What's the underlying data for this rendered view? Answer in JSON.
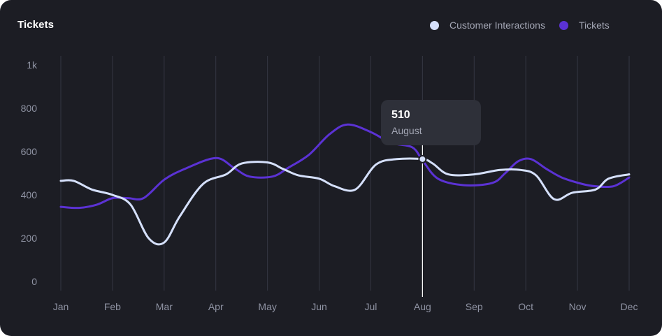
{
  "card": {
    "title": "Tickets"
  },
  "legend": {
    "items": [
      {
        "label": "Customer Interactions",
        "color": "#d5e0fb"
      },
      {
        "label": "Tickets",
        "color": "#5b32d4"
      }
    ]
  },
  "tooltip": {
    "value": "510",
    "label": "August"
  },
  "chart_data": {
    "type": "line",
    "title": "Tickets",
    "categories": [
      "Jan",
      "Feb",
      "Mar",
      "Apr",
      "May",
      "Jun",
      "Jul",
      "Aug",
      "Sep",
      "Oct",
      "Nov",
      "Dec"
    ],
    "yticks": [
      "0",
      "200",
      "400",
      "600",
      "800",
      "1k"
    ],
    "ylim": [
      0,
      1000
    ],
    "grid": "vertical",
    "legend_position": "top-right",
    "highlight": {
      "category": "Aug",
      "series": "Customer Interactions",
      "value": 510
    },
    "series": [
      {
        "name": "Customer Interactions",
        "color": "#d5e0fb",
        "points": [
          [
            0,
            465
          ],
          [
            0.25,
            465
          ],
          [
            0.6,
            425
          ],
          [
            1.0,
            400
          ],
          [
            1.35,
            355
          ],
          [
            1.7,
            200
          ],
          [
            2.0,
            180
          ],
          [
            2.3,
            300
          ],
          [
            2.75,
            450
          ],
          [
            3.2,
            495
          ],
          [
            3.5,
            545
          ],
          [
            4.0,
            550
          ],
          [
            4.3,
            520
          ],
          [
            4.6,
            490
          ],
          [
            5.0,
            475
          ],
          [
            5.3,
            440
          ],
          [
            5.7,
            425
          ],
          [
            6.1,
            540
          ],
          [
            6.5,
            565
          ],
          [
            7.0,
            565
          ],
          [
            7.2,
            545
          ],
          [
            7.5,
            495
          ],
          [
            8.0,
            495
          ],
          [
            8.5,
            515
          ],
          [
            8.9,
            515
          ],
          [
            9.2,
            490
          ],
          [
            9.55,
            380
          ],
          [
            9.9,
            410
          ],
          [
            10.35,
            425
          ],
          [
            10.6,
            475
          ],
          [
            11.0,
            495
          ]
        ]
      },
      {
        "name": "Tickets",
        "color": "#5b32d4",
        "points": [
          [
            0,
            345
          ],
          [
            0.35,
            340
          ],
          [
            0.7,
            355
          ],
          [
            1.0,
            385
          ],
          [
            1.3,
            385
          ],
          [
            1.6,
            385
          ],
          [
            2.0,
            470
          ],
          [
            2.4,
            520
          ],
          [
            3.0,
            570
          ],
          [
            3.35,
            525
          ],
          [
            3.65,
            485
          ],
          [
            4.1,
            485
          ],
          [
            4.4,
            525
          ],
          [
            4.8,
            585
          ],
          [
            5.2,
            680
          ],
          [
            5.55,
            725
          ],
          [
            6.0,
            690
          ],
          [
            6.4,
            640
          ],
          [
            6.8,
            620
          ],
          [
            7.0,
            560
          ],
          [
            7.3,
            475
          ],
          [
            7.8,
            445
          ],
          [
            8.35,
            455
          ],
          [
            8.6,
            500
          ],
          [
            8.85,
            555
          ],
          [
            9.1,
            565
          ],
          [
            9.4,
            520
          ],
          [
            9.7,
            480
          ],
          [
            10.1,
            450
          ],
          [
            10.35,
            440
          ],
          [
            10.7,
            440
          ],
          [
            11.0,
            480
          ]
        ]
      }
    ]
  }
}
